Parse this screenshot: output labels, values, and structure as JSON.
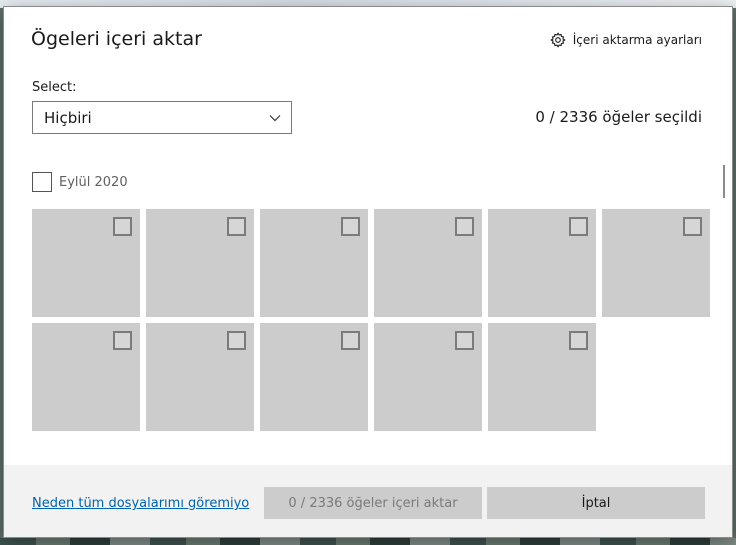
{
  "dialog": {
    "title": "Ögeleri içeri aktar",
    "settings_label": "İçeri aktarma ayarları",
    "settings_icon": "gear-icon"
  },
  "selection": {
    "label": "Select:",
    "dropdown_value": "Hiçbiri",
    "count_text": "0 / 2336 öğeler seçildi"
  },
  "group": {
    "label": "Eylül 2020",
    "checked": false
  },
  "tiles": [
    {
      "checked": false
    },
    {
      "checked": false
    },
    {
      "checked": false
    },
    {
      "checked": false
    },
    {
      "checked": false
    },
    {
      "checked": false
    },
    {
      "checked": false
    },
    {
      "checked": false
    },
    {
      "checked": false
    },
    {
      "checked": false
    },
    {
      "checked": false
    }
  ],
  "footer": {
    "help_link": "Neden tüm dosyalarımı göremiyo",
    "import_button": "0 / 2336 öğeler içeri aktar",
    "cancel_button": "İptal"
  },
  "colors": {
    "tile": "#cccccc",
    "link": "#0063b1",
    "footer_bg": "#f2f2f2"
  }
}
